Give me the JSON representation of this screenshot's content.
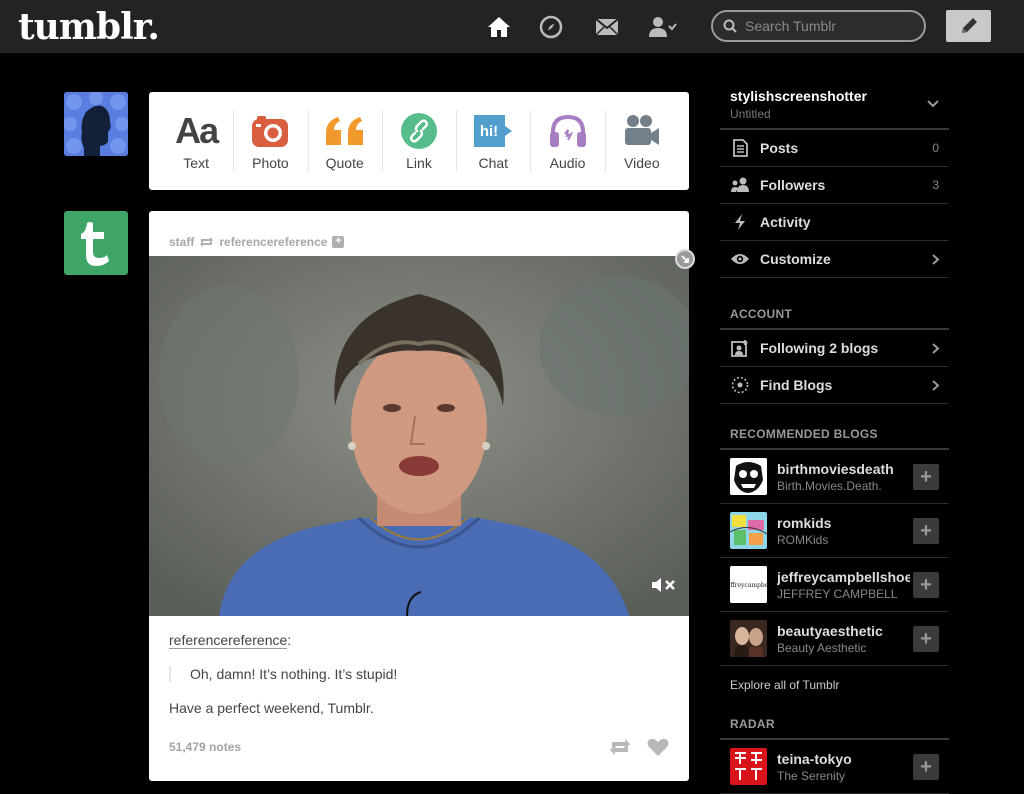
{
  "header": {
    "logo": "tumblr.",
    "search_placeholder": "Search Tumblr"
  },
  "post_types": [
    {
      "label": "Text",
      "icon": "text-icon",
      "color": "#444444"
    },
    {
      "label": "Photo",
      "icon": "camera-icon",
      "color": "#d95e40"
    },
    {
      "label": "Quote",
      "icon": "quote-icon",
      "color": "#f2992e"
    },
    {
      "label": "Link",
      "icon": "link-icon",
      "color": "#56bc8a"
    },
    {
      "label": "Chat",
      "icon": "chat-icon",
      "color": "#529ecc"
    },
    {
      "label": "Audio",
      "icon": "headphones-icon",
      "color": "#a77dc2"
    },
    {
      "label": "Video",
      "icon": "video-camera-icon",
      "color": "#748089"
    }
  ],
  "post": {
    "author": "staff",
    "reblogged_from": "referencereference",
    "source": "referencereference",
    "quote": "Oh, damn! It’s nothing. It’s stupid!",
    "text": "Have a perfect weekend, Tumblr.",
    "notes": "51,479 notes"
  },
  "sidebar": {
    "blog_name": "stylishscreenshotter",
    "blog_subtitle": "Untitled",
    "menu": [
      {
        "label": "Posts",
        "count": "0",
        "icon": "posts-icon"
      },
      {
        "label": "Followers",
        "count": "3",
        "icon": "followers-icon"
      },
      {
        "label": "Activity",
        "count": "",
        "icon": "lightning-icon"
      },
      {
        "label": "Customize",
        "count": "",
        "icon": "eye-icon"
      }
    ],
    "account_header": "ACCOUNT",
    "account": [
      {
        "label": "Following 2 blogs",
        "icon": "following-icon"
      },
      {
        "label": "Find Blogs",
        "icon": "find-blogs-icon"
      }
    ],
    "recommended_header": "RECOMMENDED BLOGS",
    "recommended": [
      {
        "name": "birthmoviesdeath",
        "subtitle": "Birth.Movies.Death."
      },
      {
        "name": "romkids",
        "subtitle": "ROMKids"
      },
      {
        "name": "jeffreycampbellshoes",
        "subtitle": "JEFFREY CAMPBELL"
      },
      {
        "name": "beautyaesthetic",
        "subtitle": "Beauty Aesthetic"
      }
    ],
    "explore": "Explore all of Tumblr",
    "radar_header": "RADAR",
    "radar": {
      "name": "teina-tokyo",
      "subtitle": "The Serenity"
    }
  }
}
